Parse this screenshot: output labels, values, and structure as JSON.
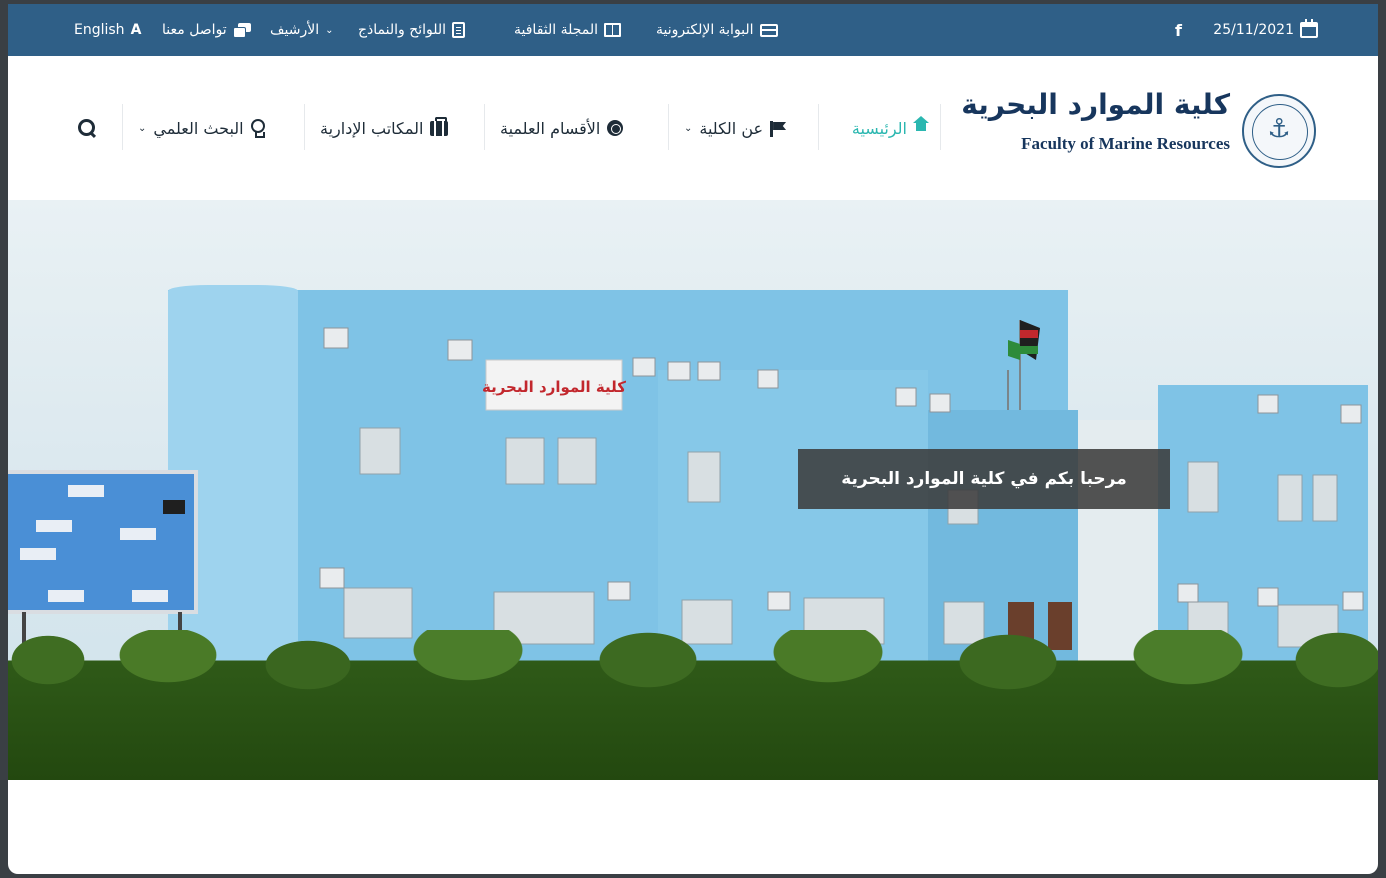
{
  "topbar": {
    "date": "25/11/2021",
    "facebook_icon": "facebook-icon",
    "links": [
      {
        "label": "البوابة الإلكترونية",
        "icon": "credit-card-icon"
      },
      {
        "label": "المجلة الثقافية",
        "icon": "book-icon"
      },
      {
        "label": "اللوائح والنماذج",
        "icon": "document-icon"
      },
      {
        "label": "الأرشيف",
        "icon": "chevron-down-icon"
      },
      {
        "label": "تواصل معنا",
        "icon": "chat-icon"
      },
      {
        "label": "English",
        "icon": "language-icon"
      }
    ],
    "colors": {
      "background": "#2f5f87",
      "text": "#ffffff"
    }
  },
  "logo": {
    "arabic": "كلية الموارد البحرية",
    "english": "Faculty of Marine Resources"
  },
  "nav": {
    "items": [
      {
        "label": "الرئيسية",
        "icon": "home-icon",
        "active": true
      },
      {
        "label": "عن الكلية",
        "icon": "flag-icon",
        "dropdown": true
      },
      {
        "label": "الأقسام العلمية",
        "icon": "globe-icon"
      },
      {
        "label": "المكاتب الإدارية",
        "icon": "briefcase-icon"
      },
      {
        "label": "البحث العلمي",
        "icon": "lightbulb-icon",
        "dropdown": true
      }
    ],
    "search_icon": "search-icon",
    "colors": {
      "active": "#2bb7b0",
      "text": "#1e2c38"
    }
  },
  "hero": {
    "welcome_text": "مرحبا بكم في كلية الموارد البحرية",
    "building_sign": "كلية الموارد البحرية"
  }
}
